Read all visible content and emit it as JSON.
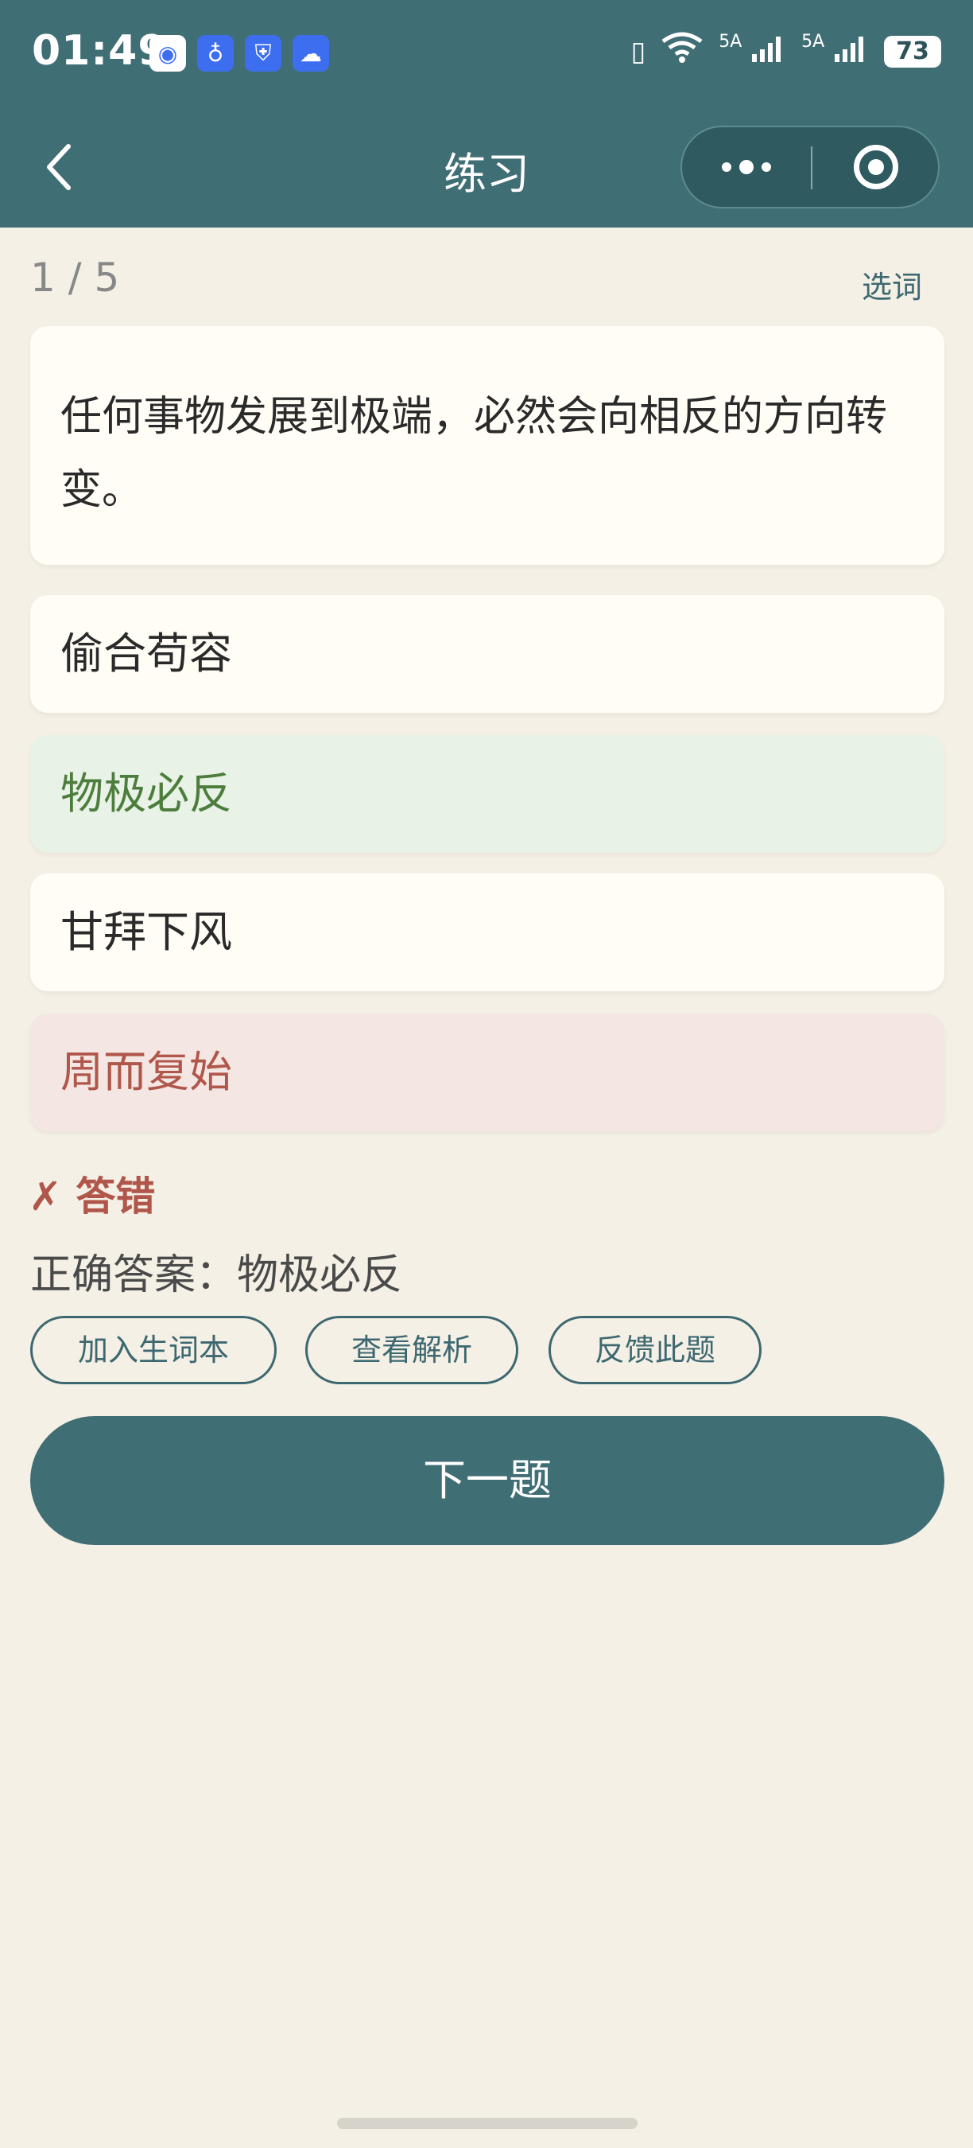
{
  "status_bar": {
    "time": "01:49",
    "app_icons": [
      "browser-icon",
      "bulb-icon",
      "shield-icon",
      "cloud-icon"
    ],
    "network": "5A",
    "network2": "5A",
    "battery": "73"
  },
  "nav": {
    "title": "练习",
    "back_icon": "chevron-left-icon",
    "more_icon": "more-dots-icon",
    "close_icon": "target-icon"
  },
  "progress": "1 / 5",
  "select_word_label": "选词",
  "question": "任何事物发展到极端，必然会向相反的方向转变。",
  "options": [
    {
      "label": "偷合苟容",
      "state": "normal"
    },
    {
      "label": "物极必反",
      "state": "correct"
    },
    {
      "label": "甘拜下风",
      "state": "normal"
    },
    {
      "label": "周而复始",
      "state": "wrong"
    }
  ],
  "result": {
    "icon": "✗",
    "text": "答错"
  },
  "correct_answer": "正确答案：物极必反",
  "actions": {
    "add_vocab": "加入生词本",
    "view_analysis": "查看解析",
    "feedback": "反馈此题"
  },
  "next_button": "下一题",
  "colors": {
    "primary": "#406e75",
    "background": "#f4f0e6",
    "correct": "#4d7d3c",
    "wrong": "#b0564a"
  }
}
